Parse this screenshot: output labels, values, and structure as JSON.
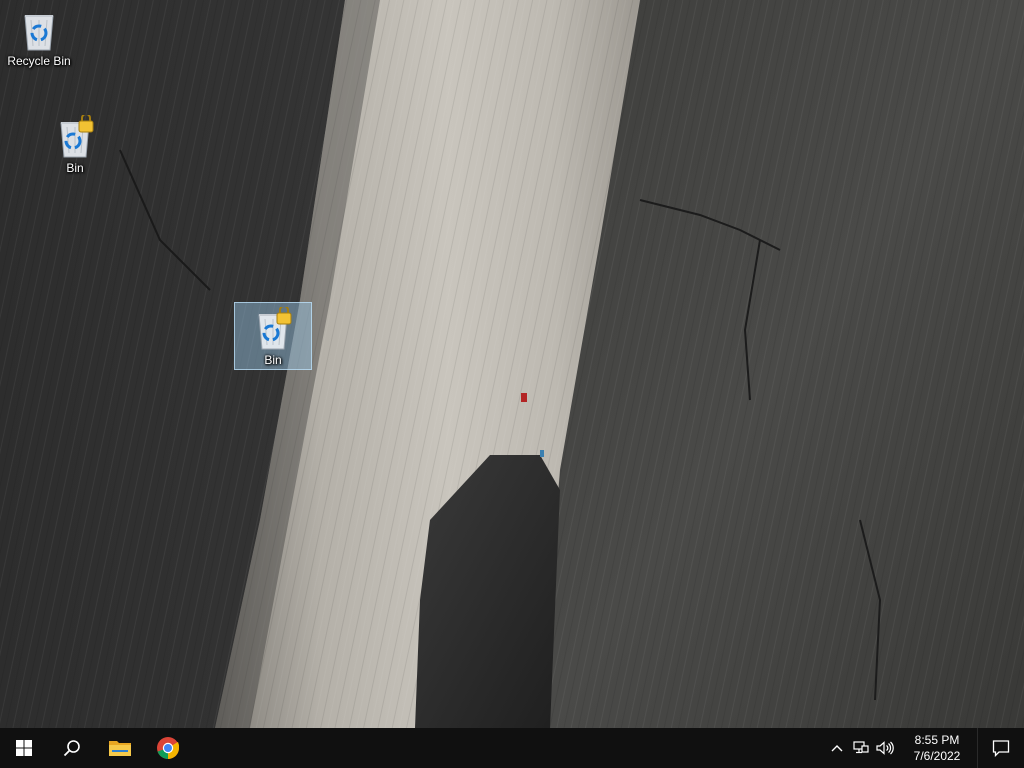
{
  "desktop": {
    "icons": [
      {
        "label": "Recycle Bin",
        "icon": "recycle-bin-icon",
        "selected": false
      },
      {
        "label": "Bin",
        "icon": "recycle-bin-locked-icon",
        "selected": false
      },
      {
        "label": "Bin",
        "icon": "recycle-bin-locked-icon",
        "selected": true
      }
    ]
  },
  "taskbar": {
    "buttons": [
      {
        "name": "start-button",
        "icon": "windows-logo-icon"
      },
      {
        "name": "search-button",
        "icon": "search-icon"
      },
      {
        "name": "file-explorer-button",
        "icon": "folder-icon"
      },
      {
        "name": "chrome-button",
        "icon": "chrome-icon"
      }
    ],
    "tray": {
      "icons": [
        "chevron-up-icon",
        "network-icon",
        "volume-icon"
      ],
      "time": "8:55 PM",
      "date": "7/6/2022",
      "notification_icon": "notification-icon"
    }
  },
  "colors": {
    "taskbar_bg": "#101010",
    "selection": "#99c7e8",
    "lock_badge": "#f2c233",
    "recycle_blue": "#1b79d4"
  }
}
